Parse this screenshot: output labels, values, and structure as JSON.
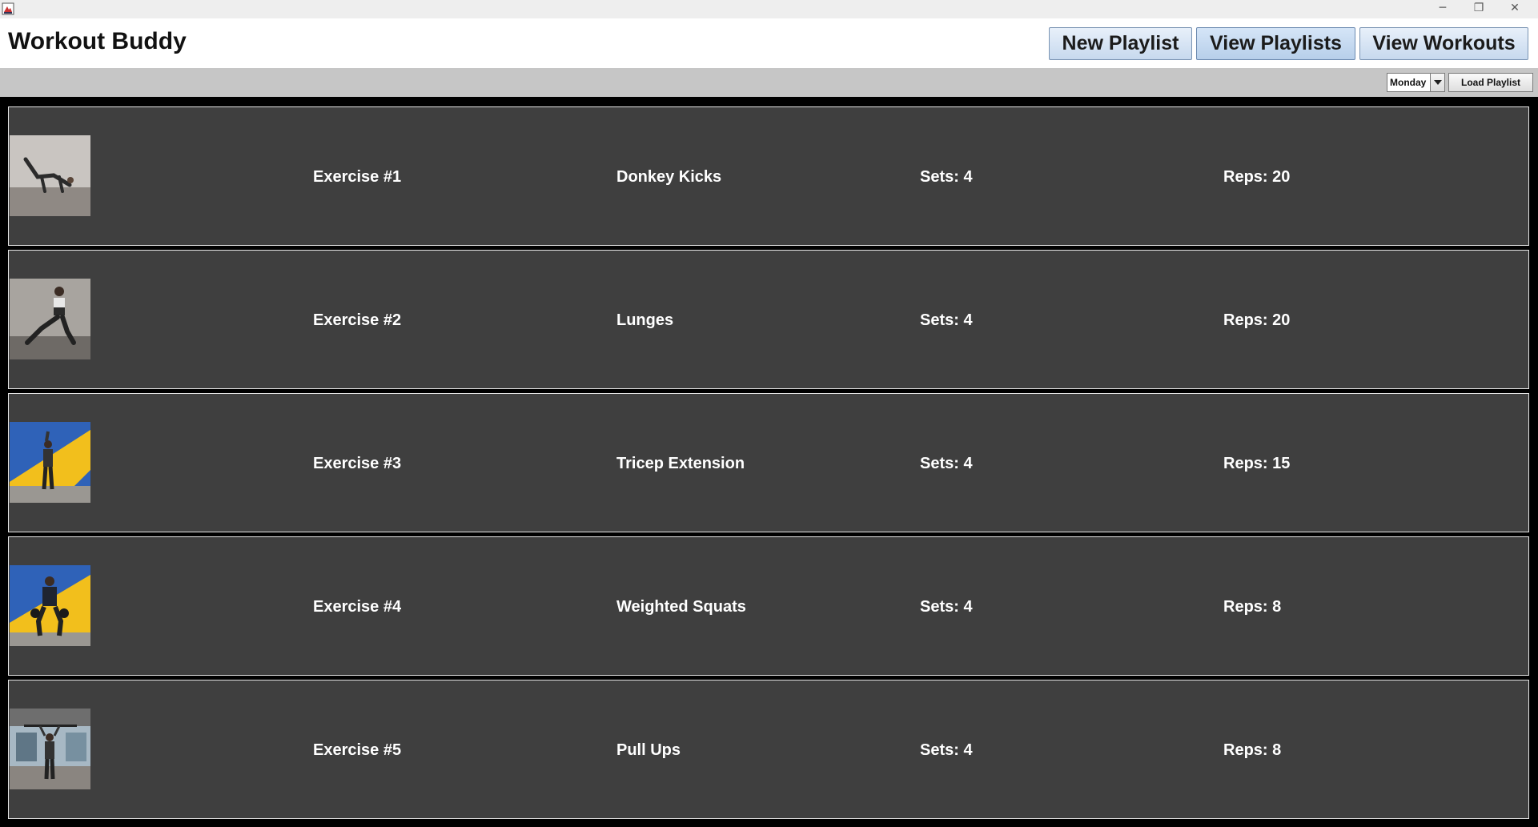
{
  "window": {
    "minimize_glyph": "─",
    "maximize_glyph": "❐",
    "close_glyph": "✕"
  },
  "header": {
    "title": "Workout Buddy",
    "nav": {
      "new_playlist": "New Playlist",
      "view_playlists": "View Playlists",
      "view_workouts": "View Workouts"
    }
  },
  "toolbar": {
    "day_selected": "Monday",
    "load_label": "Load Playlist"
  },
  "exercises": [
    {
      "number": "Exercise #1",
      "name": "Donkey Kicks",
      "sets": "Sets: 4",
      "reps": "Reps: 20",
      "image": "donkey-kicks-photo"
    },
    {
      "number": "Exercise #2",
      "name": "Lunges",
      "sets": "Sets: 4",
      "reps": "Reps: 20",
      "image": "lunges-photo"
    },
    {
      "number": "Exercise #3",
      "name": "Tricep Extension",
      "sets": "Sets: 4",
      "reps": "Reps: 15",
      "image": "tricep-extension-photo"
    },
    {
      "number": "Exercise #4",
      "name": "Weighted Squats",
      "sets": "Sets: 4",
      "reps": "Reps: 8",
      "image": "weighted-squats-photo"
    },
    {
      "number": "Exercise #5",
      "name": "Pull Ups",
      "sets": "Sets: 4",
      "reps": "Reps: 8",
      "image": "pull-ups-photo"
    }
  ],
  "colors": {
    "row_bg": "#3f3f3f",
    "row_border": "#e6e6e6",
    "toolbar_bg": "#c6c6c6",
    "accent_blue": "#2f62b8",
    "accent_yellow": "#f2bf1c"
  }
}
